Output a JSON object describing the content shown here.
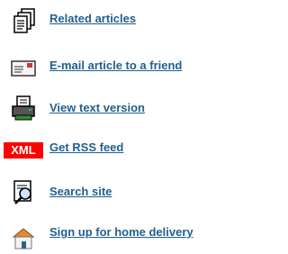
{
  "tools": [
    {
      "label": "Related articles",
      "icon": "related-articles-icon"
    },
    {
      "label": "E-mail article to a friend",
      "icon": "email-icon"
    },
    {
      "label": "View text version",
      "icon": "printer-icon"
    },
    {
      "label": "Get RSS feed",
      "icon": "xml-rss-icon",
      "icon_text": "XML"
    },
    {
      "label": "Search site",
      "icon": "search-magnifier-icon"
    },
    {
      "label": "Sign up for home delivery",
      "icon": "home-delivery-icon"
    }
  ],
  "colors": {
    "link": "#1f5f8f",
    "xml_badge": "#ff0000"
  }
}
